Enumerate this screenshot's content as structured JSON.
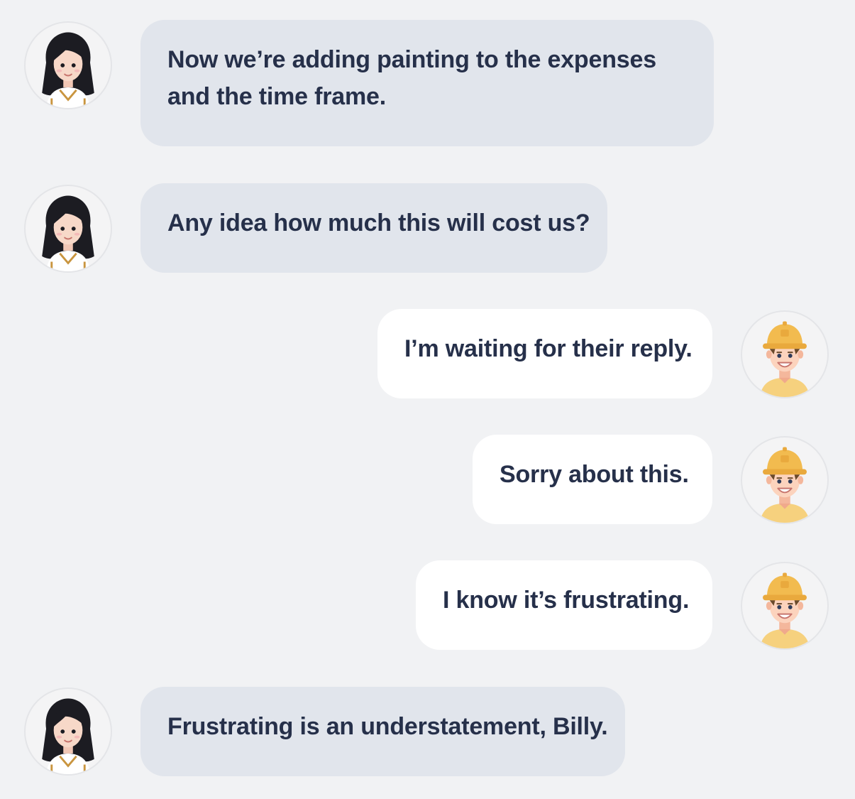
{
  "messages": [
    {
      "side": "left",
      "sender": "woman",
      "text": "Now we’re adding painting to the expenses and the time frame."
    },
    {
      "side": "left",
      "sender": "woman",
      "text": "Any idea how much this will cost us?"
    },
    {
      "side": "right",
      "sender": "worker",
      "text": "I’m waiting for their reply."
    },
    {
      "side": "right",
      "sender": "worker",
      "text": "Sorry about this."
    },
    {
      "side": "right",
      "sender": "worker",
      "text": "I know it’s frustrating."
    },
    {
      "side": "left",
      "sender": "woman",
      "text": "Frustrating is an understatement, Billy."
    }
  ],
  "colors": {
    "background": "#f1f2f4",
    "incoming_bubble": "#e1e5ec",
    "outgoing_bubble": "#ffffff",
    "text": "#26304a",
    "hard_hat": "#f2bb4f"
  },
  "icons": {
    "woman": "woman-avatar-icon",
    "worker": "construction-worker-avatar-icon"
  }
}
